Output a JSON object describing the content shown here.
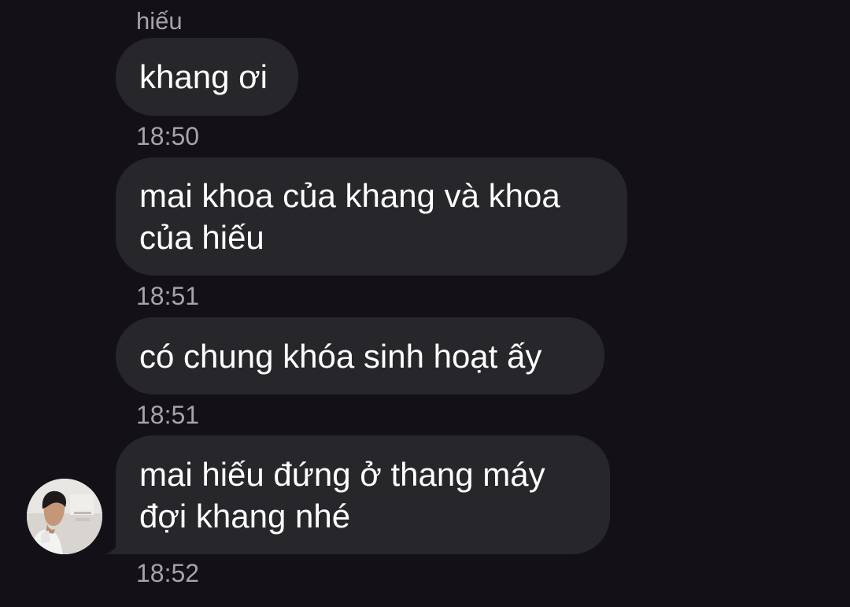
{
  "chat": {
    "sender_name": "hiếu",
    "messages": [
      {
        "text": "khang ơi",
        "time": "18:50"
      },
      {
        "text": "mai khoa của khang và khoa của hiếu",
        "time": "18:51"
      },
      {
        "text": "có chung khóa sinh hoạt ấy",
        "time": "18:51"
      },
      {
        "text": "mai hiếu đứng ở thang máy đợi khang nhé",
        "time": "18:52"
      }
    ]
  },
  "colors": {
    "background": "#141018",
    "bubble": "#27262b",
    "meta_text": "#a6a3ab",
    "message_text": "#ffffff"
  },
  "icons": {
    "avatar": "sender-avatar-photo"
  }
}
